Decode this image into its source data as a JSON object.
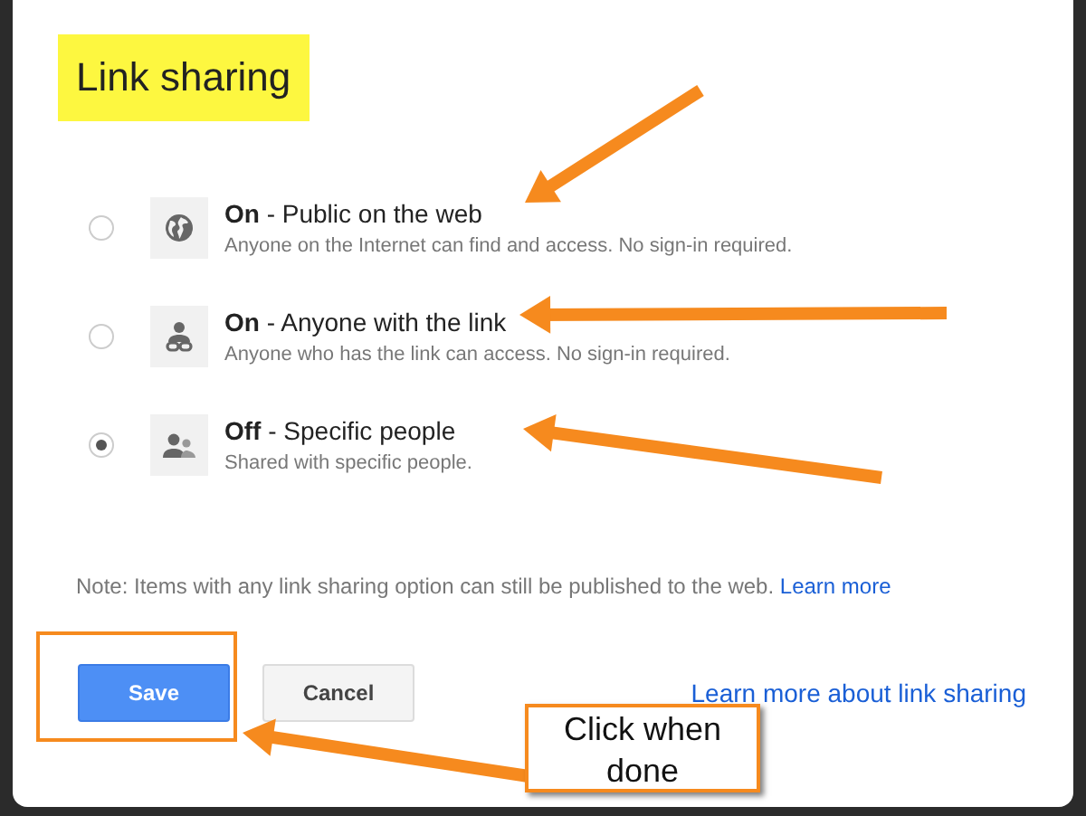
{
  "dialog": {
    "title": "Link sharing",
    "options": [
      {
        "kind": "public",
        "label": "**On** - Public on the web",
        "description": "Anyone on the Internet can find and access. No sign-in required.",
        "selected": false
      },
      {
        "kind": "link",
        "label": "**On** - Anyone with the link",
        "description": "Anyone who has the link can access. No sign-in required.",
        "selected": false
      },
      {
        "kind": "private",
        "label": "**Off** - Specific people",
        "description": "Shared with specific people.",
        "selected": true
      }
    ],
    "note": "Note: Items with any link sharing option can still be published to the web.",
    "note_link": "Learn more",
    "buttons": [
      {
        "kind": "primary",
        "label": "Save"
      },
      {
        "kind": "secondary",
        "label": "Cancel"
      }
    ],
    "help_link": "Learn more about link sharing"
  },
  "annotation": {
    "callout": "Click when done"
  }
}
